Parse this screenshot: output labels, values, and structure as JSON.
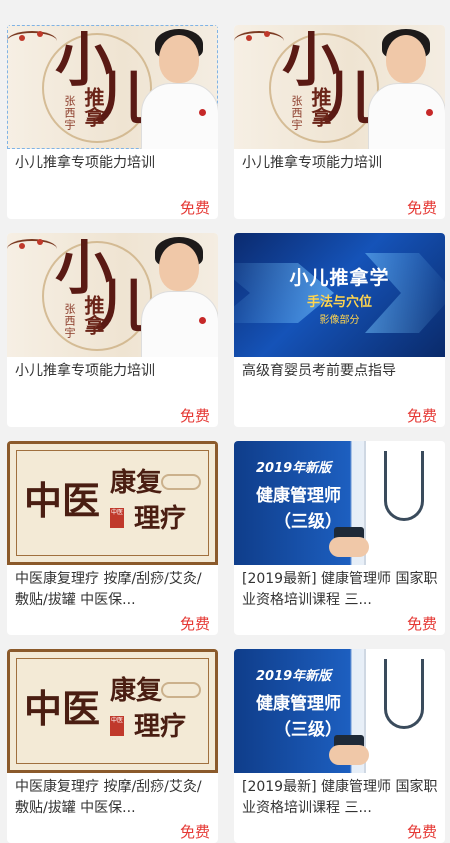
{
  "cards": [
    {
      "title": "小儿推拿专项能力培训",
      "price": "免费",
      "thumb": {
        "big1": "小",
        "big2": "儿",
        "small": "推拿",
        "seal": "张西宇"
      }
    },
    {
      "title": "小儿推拿专项能力培训",
      "price": "免费",
      "thumb": {
        "big1": "小",
        "big2": "儿",
        "small": "推拿",
        "seal": "张西宇"
      }
    },
    {
      "title": "小儿推拿专项能力培训",
      "price": "免费",
      "thumb": {
        "big1": "小",
        "big2": "儿",
        "small": "推拿",
        "seal": "张西宇"
      }
    },
    {
      "title": "高级育婴员考前要点指导",
      "price": "免费",
      "thumb": {
        "line1": "小儿推拿学",
        "line2": "手法与穴位",
        "line3": "影像部分"
      }
    },
    {
      "title": "中医康复理疗 按摩/刮痧/艾灸/敷贴/拔罐 中医保...",
      "price": "免费",
      "thumb": {
        "zy": "中医",
        "kf": "康复",
        "ll": "理疗",
        "chop": "中医"
      }
    },
    {
      "title": "[2019最新] 健康管理师 国家职业资格培训课程 三...",
      "price": "免费",
      "thumb": {
        "year": "2019年新版",
        "name": "健康管理师",
        "level": "（三级）"
      }
    },
    {
      "title": "中医康复理疗 按摩/刮痧/艾灸/敷贴/拔罐 中医保...",
      "price": "免费",
      "thumb": {
        "zy": "中医",
        "kf": "康复",
        "ll": "理疗",
        "chop": "中医"
      }
    },
    {
      "title": "[2019最新] 健康管理师 国家职业资格培训课程 三...",
      "price": "免费",
      "thumb": {
        "year": "2019年新版",
        "name": "健康管理师",
        "level": "（三级）"
      }
    }
  ]
}
